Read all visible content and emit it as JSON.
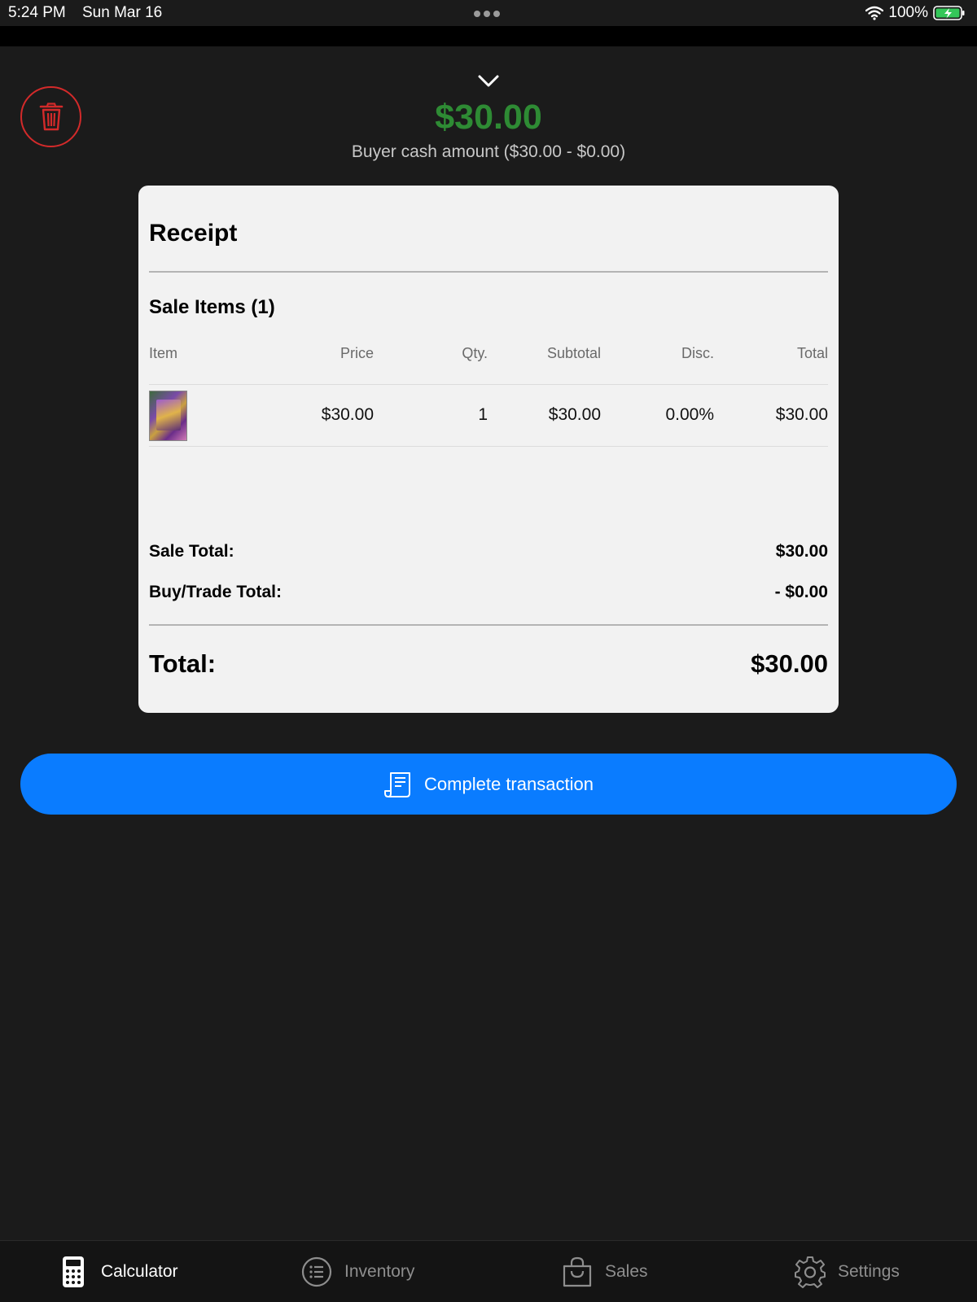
{
  "status_bar": {
    "time": "5:24 PM",
    "date": "Sun Mar 16",
    "battery": "100%"
  },
  "header": {
    "amount": "$30.00",
    "subtitle": "Buyer cash amount  ($30.00 - $0.00)",
    "amount_color": "#2e8b34"
  },
  "receipt": {
    "title": "Receipt",
    "section_title": "Sale Items (1)",
    "columns": [
      "Item",
      "Price",
      "Qty.",
      "Subtotal",
      "Disc.",
      "Total"
    ],
    "rows": [
      {
        "price": "$30.00",
        "qty": "1",
        "subtotal": "$30.00",
        "disc": "0.00%",
        "total": "$30.00"
      }
    ],
    "sale_total_label": "Sale Total:",
    "sale_total_value": "$30.00",
    "buy_trade_label": "Buy/Trade Total:",
    "buy_trade_value": "- $0.00",
    "total_label": "Total:",
    "total_value": "$30.00"
  },
  "actions": {
    "complete_label": "Complete transaction",
    "accent_color": "#0a7cff",
    "delete_color": "#d32a2a"
  },
  "tab_bar": {
    "tabs": [
      {
        "label": "Calculator",
        "icon": "calculator-icon",
        "active": true
      },
      {
        "label": "Inventory",
        "icon": "list-icon",
        "active": false
      },
      {
        "label": "Sales",
        "icon": "shopping-bag-icon",
        "active": false
      },
      {
        "label": "Settings",
        "icon": "gear-icon",
        "active": false
      }
    ]
  }
}
